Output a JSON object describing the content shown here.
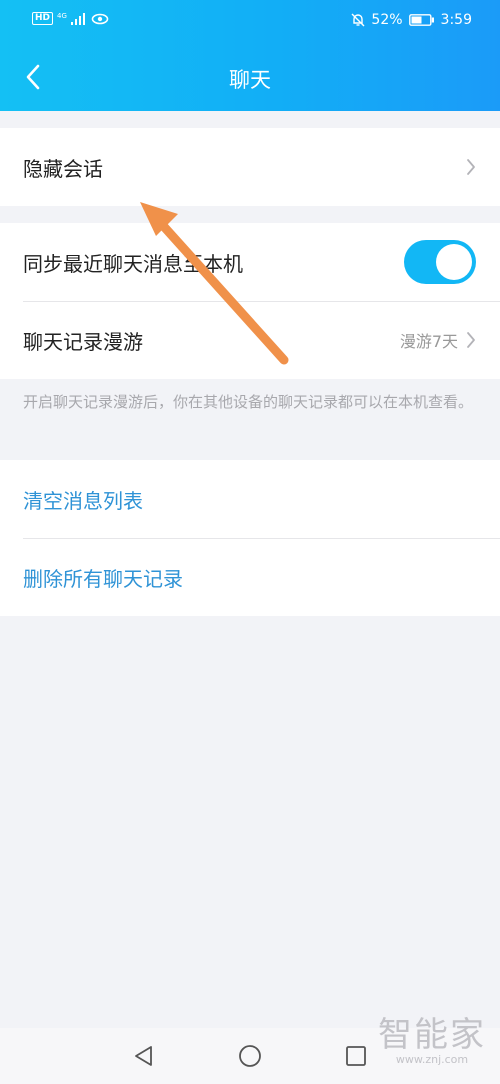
{
  "status_bar": {
    "hd": "HD",
    "network": "4G",
    "battery": "52%",
    "time": "3:59"
  },
  "nav": {
    "title": "聊天"
  },
  "rows": {
    "hidden_chats": "隐藏会话",
    "sync_recent": "同步最近聊天消息至本机",
    "roaming": "聊天记录漫游",
    "roaming_value": "漫游7天"
  },
  "sync_toggle": {
    "on": true
  },
  "note": "开启聊天记录漫游后，你在其他设备的聊天记录都可以在本机查看。",
  "actions": {
    "clear_list": "清空消息列表",
    "delete_all": "删除所有聊天记录"
  },
  "watermark": {
    "main": "智能家",
    "sub": "www.znj.com"
  },
  "colors": {
    "header": "#12aef6",
    "accent": "#12b7f5",
    "link": "#2f93d6",
    "annotation_arrow": "#f0914a"
  }
}
